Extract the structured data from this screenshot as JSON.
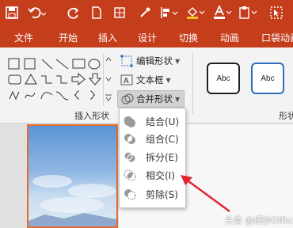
{
  "tabs": [
    "文件",
    "开始",
    "插入",
    "设计",
    "切换",
    "动画",
    "口袋动画"
  ],
  "ribbon": {
    "edit_shape": "编辑形状",
    "text_box": "文本框",
    "merge_shapes": "合并形状",
    "group_insert_shapes": "插入形状",
    "group_shape_styles": "形状",
    "style_sample_1": "Abc",
    "style_sample_2": "Abc"
  },
  "merge_menu": [
    {
      "label": "结合(U)",
      "icon": "union-icon"
    },
    {
      "label": "组合(C)",
      "icon": "combine-icon"
    },
    {
      "label": "拆分(E)",
      "icon": "fragment-icon"
    },
    {
      "label": "相交(I)",
      "icon": "intersect-icon"
    },
    {
      "label": "剪除(S)",
      "icon": "subtract-icon"
    }
  ],
  "watermark": "头条 @爆炒Office",
  "colors": {
    "ribbon_bar": "#c43e1c",
    "arrow": "#e0262f"
  }
}
